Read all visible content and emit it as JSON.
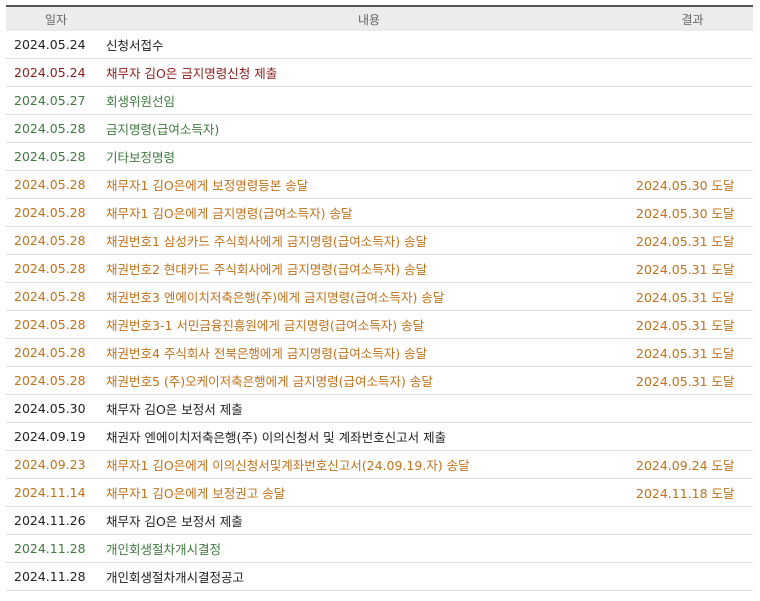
{
  "header": {
    "date": "일자",
    "content": "내용",
    "result": "결과"
  },
  "colors": {
    "black": "#222222",
    "maroon": "#8b1a1a",
    "green": "#3f7a3f",
    "orange": "#c0711a"
  },
  "rows": [
    {
      "date": "2024.05.24",
      "content": "신청서접수",
      "result": "",
      "color": "#222222"
    },
    {
      "date": "2024.05.24",
      "content": "채무자 김O은 금지명령신청 제출",
      "result": "",
      "color": "#8b1a1a"
    },
    {
      "date": "2024.05.27",
      "content": "회생위원선임",
      "result": "",
      "color": "#3f7a3f"
    },
    {
      "date": "2024.05.28",
      "content": "금지명령(급여소득자)",
      "result": "",
      "color": "#3f7a3f"
    },
    {
      "date": "2024.05.28",
      "content": "기타보정명령",
      "result": "",
      "color": "#3f7a3f"
    },
    {
      "date": "2024.05.28",
      "content": "채무자1 김O은에게 보정명령등본 송달",
      "result": "2024.05.30 도달",
      "color": "#c0711a"
    },
    {
      "date": "2024.05.28",
      "content": "채무자1 김O은에게 금지명령(급여소득자) 송달",
      "result": "2024.05.30 도달",
      "color": "#c0711a"
    },
    {
      "date": "2024.05.28",
      "content": "채권번호1 삼성카드 주식회사에게 금지명령(급여소득자) 송달",
      "result": "2024.05.31 도달",
      "color": "#c0711a"
    },
    {
      "date": "2024.05.28",
      "content": "채권번호2 현대카드 주식회사에게 금지명령(급여소득자) 송달",
      "result": "2024.05.31 도달",
      "color": "#c0711a"
    },
    {
      "date": "2024.05.28",
      "content": "채권번호3 엔에이치저축은행(주)에게 금지명령(급여소득자) 송달",
      "result": "2024.05.31 도달",
      "color": "#c0711a"
    },
    {
      "date": "2024.05.28",
      "content": "채권번호3-1 서민금융진흥원에게 금지명령(급여소득자) 송달",
      "result": "2024.05.31 도달",
      "color": "#c0711a"
    },
    {
      "date": "2024.05.28",
      "content": "채권번호4 주식회사 전북은행에게 금지명령(급여소득자) 송달",
      "result": "2024.05.31 도달",
      "color": "#c0711a"
    },
    {
      "date": "2024.05.28",
      "content": "채권번호5 (주)오케이저축은행에게 금지명령(급여소득자) 송달",
      "result": "2024.05.31 도달",
      "color": "#c0711a"
    },
    {
      "date": "2024.05.30",
      "content": "채무자 김O은 보정서 제출",
      "result": "",
      "color": "#222222"
    },
    {
      "date": "2024.09.19",
      "content": "채권자 엔에이치저축은행(주) 이의신청서 및 계좌번호신고서 제출",
      "result": "",
      "color": "#222222"
    },
    {
      "date": "2024.09.23",
      "content": "채무자1 김O은에게 이의신청서및계좌번호신고서(24.09.19.자) 송달",
      "result": "2024.09.24 도달",
      "color": "#c0711a"
    },
    {
      "date": "2024.11.14",
      "content": "채무자1 김O은에게 보정권고 송달",
      "result": "2024.11.18 도달",
      "color": "#c0711a"
    },
    {
      "date": "2024.11.26",
      "content": "채무자 김O은 보정서 제출",
      "result": "",
      "color": "#222222"
    },
    {
      "date": "2024.11.28",
      "content": "개인회생절차개시결정",
      "result": "",
      "color": "#3f7a3f"
    },
    {
      "date": "2024.11.28",
      "content": "개인회생절차개시결정공고",
      "result": "",
      "color": "#222222"
    }
  ]
}
